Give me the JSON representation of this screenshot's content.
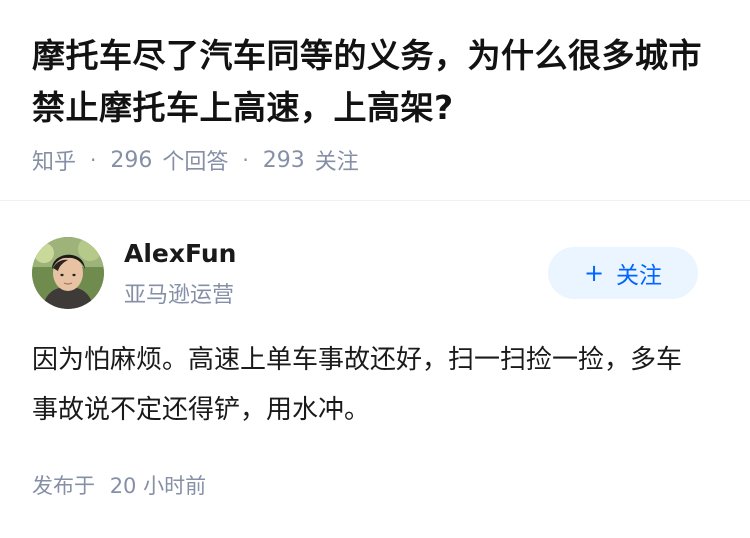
{
  "question": {
    "title": "摩托车尽了汽车同等的义务，为什么很多城市禁止摩托车上高速，上高架?",
    "source": "知乎",
    "answer_count": "296",
    "answer_label": "个回答",
    "follower_count": "293",
    "follower_label": "关注"
  },
  "answer": {
    "author": {
      "name": "AlexFun",
      "headline": "亚马逊运营",
      "avatar_icon": "user-avatar-photo"
    },
    "follow_button": {
      "icon": "plus-icon",
      "plus": "+",
      "label": "关注"
    },
    "content": "因为怕麻烦。高速上单车事故还好，扫一扫捡一捡，多车事故说不定还得铲，用水冲。",
    "time_prefix": "发布于",
    "time_value": "20 小时前"
  },
  "colors": {
    "meta_gray": "#8590a6",
    "accent_blue": "#0066ff",
    "follow_bg": "#ebf5ff"
  }
}
